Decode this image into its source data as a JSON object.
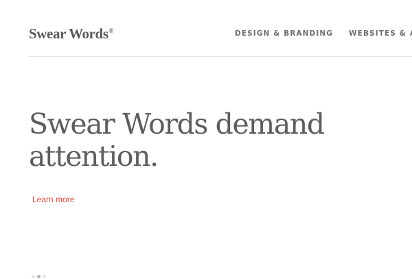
{
  "header": {
    "logo": "Swear Words",
    "logo_mark": "®",
    "nav": [
      {
        "label": "DESIGN & BRANDING"
      },
      {
        "label": "WEBSITES & AP"
      }
    ]
  },
  "hero": {
    "headline": "Swear Words demand attention.",
    "cta": "Learn more"
  },
  "carousel": {
    "slides": 3,
    "active_slide": 2
  },
  "colors": {
    "text": "#5d5d5d",
    "accent": "#d84d45",
    "divider": "#e2e2e2"
  }
}
